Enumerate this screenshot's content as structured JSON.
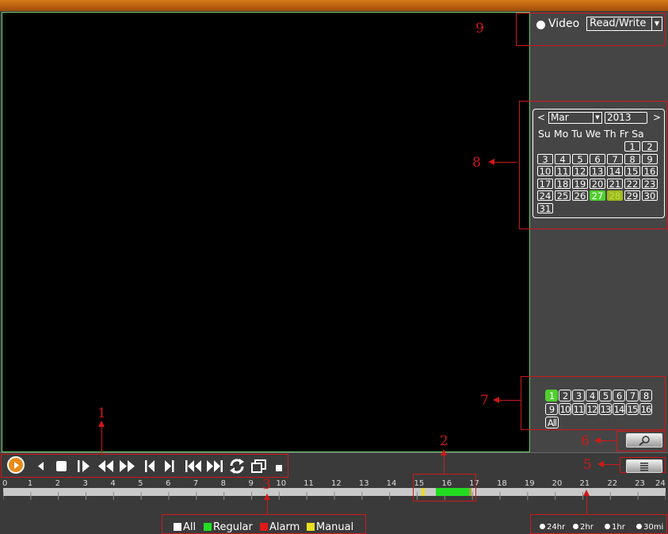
{
  "mode": {
    "radio_label": "Video",
    "selected": "Read/Write"
  },
  "calendar": {
    "month": "Mar",
    "year": "2013",
    "prev": "<",
    "next": ">",
    "weekdays": "Su Mo Tu We Th Fr Sa",
    "days": [
      "1",
      "2",
      "3",
      "4",
      "5",
      "6",
      "7",
      "8",
      "9",
      "10",
      "11",
      "12",
      "13",
      "14",
      "15",
      "16",
      "17",
      "18",
      "19",
      "20",
      "21",
      "22",
      "23",
      "24",
      "25",
      "26",
      "27",
      "28",
      "29",
      "30",
      "31"
    ],
    "recorded_day": "27",
    "today": "28"
  },
  "channels": [
    "1",
    "2",
    "3",
    "4",
    "5",
    "6",
    "7",
    "8",
    "9",
    "10",
    "11",
    "12",
    "13",
    "14",
    "15",
    "16",
    "All"
  ],
  "timeline": {
    "hours": [
      "0",
      "1",
      "2",
      "3",
      "4",
      "5",
      "6",
      "7",
      "8",
      "9",
      "10",
      "11",
      "12",
      "13",
      "14",
      "15",
      "16",
      "17",
      "18",
      "19",
      "20",
      "21",
      "22",
      "23",
      "24"
    ]
  },
  "legend": {
    "all": "All",
    "regular": "Regular",
    "alarm": "Alarm",
    "manual": "Manual"
  },
  "zoom": {
    "z24": "24hr",
    "z2": "2hr",
    "z1": "1hr",
    "z30": "30mi"
  },
  "annotations": {
    "n1": "1",
    "n2": "2",
    "n3": "3",
    "n5": "5",
    "n6": "6",
    "n7": "7",
    "n8": "8",
    "n9": "9"
  },
  "colors": {
    "accent_green": "#4fcf2f",
    "annotation_red": "#d01818",
    "top_bar": "#d87a1a",
    "manual_yellow": "#e8e020"
  }
}
